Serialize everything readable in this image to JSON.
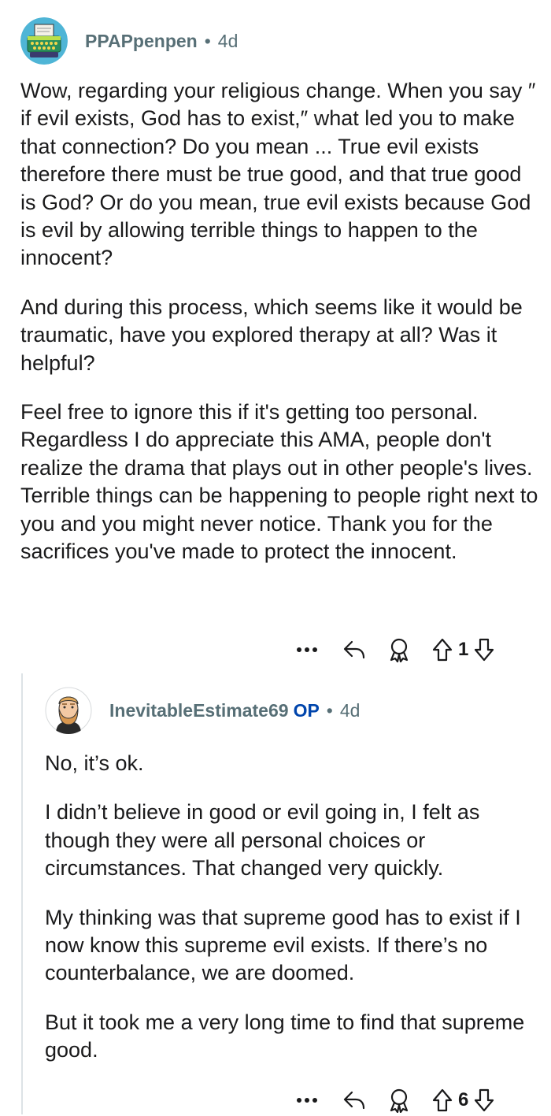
{
  "comments": [
    {
      "username": "PPAPpenpen",
      "age": "4d",
      "paragraphs": [
        "Wow, regarding your religious change. When you say ″ if evil exists, God has to exist,″ what led you to make that connection? Do you mean ... True evil exists therefore there must be true good, and that true good is God? Or do you mean, true evil exists because God is evil by allowing terrible things to happen to the innocent?",
        "And during this process, which seems like it would be traumatic, have you explored therapy at all? Was it helpful?",
        "Feel free to ignore this if it's getting too personal. Regardless I do appreciate this AMA, people don't realize the drama that plays out in other people's lives. Terrible things can be happening to people right next to you and you might never notice. Thank you for the sacrifices you've made to protect the innocent."
      ],
      "vote_count": "1",
      "avatar_icon": "typewriter-avatar-icon"
    },
    {
      "username": "InevitableEstimate69",
      "op_badge": "OP",
      "age": "4d",
      "paragraphs": [
        "No, it’s ok.",
        "I didn’t believe in good or evil going in, I felt as though they were all personal choices or circumstances. That changed very quickly.",
        "My thinking was that supreme good has to exist if I now know this supreme evil exists. If there’s no counterbalance, we are doomed.",
        "But it took me a very long time to find that supreme good."
      ],
      "vote_count": "6",
      "avatar_icon": "bearded-man-avatar-icon"
    }
  ],
  "separator": "•",
  "icons": [
    "more-options-icon",
    "reply-icon",
    "award-icon",
    "upvote-icon",
    "downvote-icon"
  ],
  "colors": {
    "meta_text": "#576f76",
    "op_badge": "#0045ac",
    "body_text": "#1a1a1b",
    "thread_line": "#dde3e6"
  }
}
